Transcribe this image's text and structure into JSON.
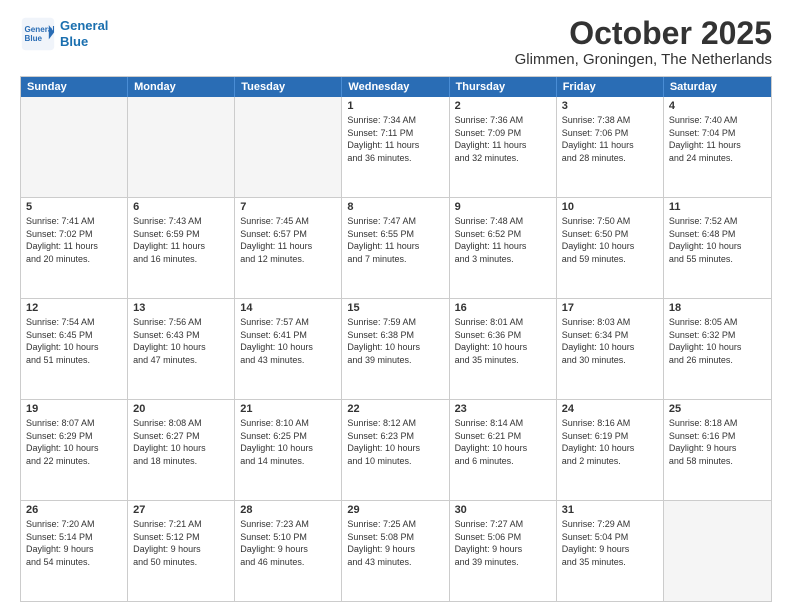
{
  "logo": {
    "line1": "General",
    "line2": "Blue"
  },
  "title": "October 2025",
  "subtitle": "Glimmen, Groningen, The Netherlands",
  "weekdays": [
    "Sunday",
    "Monday",
    "Tuesday",
    "Wednesday",
    "Thursday",
    "Friday",
    "Saturday"
  ],
  "rows": [
    [
      {
        "day": "",
        "info": ""
      },
      {
        "day": "",
        "info": ""
      },
      {
        "day": "",
        "info": ""
      },
      {
        "day": "1",
        "info": "Sunrise: 7:34 AM\nSunset: 7:11 PM\nDaylight: 11 hours\nand 36 minutes."
      },
      {
        "day": "2",
        "info": "Sunrise: 7:36 AM\nSunset: 7:09 PM\nDaylight: 11 hours\nand 32 minutes."
      },
      {
        "day": "3",
        "info": "Sunrise: 7:38 AM\nSunset: 7:06 PM\nDaylight: 11 hours\nand 28 minutes."
      },
      {
        "day": "4",
        "info": "Sunrise: 7:40 AM\nSunset: 7:04 PM\nDaylight: 11 hours\nand 24 minutes."
      }
    ],
    [
      {
        "day": "5",
        "info": "Sunrise: 7:41 AM\nSunset: 7:02 PM\nDaylight: 11 hours\nand 20 minutes."
      },
      {
        "day": "6",
        "info": "Sunrise: 7:43 AM\nSunset: 6:59 PM\nDaylight: 11 hours\nand 16 minutes."
      },
      {
        "day": "7",
        "info": "Sunrise: 7:45 AM\nSunset: 6:57 PM\nDaylight: 11 hours\nand 12 minutes."
      },
      {
        "day": "8",
        "info": "Sunrise: 7:47 AM\nSunset: 6:55 PM\nDaylight: 11 hours\nand 7 minutes."
      },
      {
        "day": "9",
        "info": "Sunrise: 7:48 AM\nSunset: 6:52 PM\nDaylight: 11 hours\nand 3 minutes."
      },
      {
        "day": "10",
        "info": "Sunrise: 7:50 AM\nSunset: 6:50 PM\nDaylight: 10 hours\nand 59 minutes."
      },
      {
        "day": "11",
        "info": "Sunrise: 7:52 AM\nSunset: 6:48 PM\nDaylight: 10 hours\nand 55 minutes."
      }
    ],
    [
      {
        "day": "12",
        "info": "Sunrise: 7:54 AM\nSunset: 6:45 PM\nDaylight: 10 hours\nand 51 minutes."
      },
      {
        "day": "13",
        "info": "Sunrise: 7:56 AM\nSunset: 6:43 PM\nDaylight: 10 hours\nand 47 minutes."
      },
      {
        "day": "14",
        "info": "Sunrise: 7:57 AM\nSunset: 6:41 PM\nDaylight: 10 hours\nand 43 minutes."
      },
      {
        "day": "15",
        "info": "Sunrise: 7:59 AM\nSunset: 6:38 PM\nDaylight: 10 hours\nand 39 minutes."
      },
      {
        "day": "16",
        "info": "Sunrise: 8:01 AM\nSunset: 6:36 PM\nDaylight: 10 hours\nand 35 minutes."
      },
      {
        "day": "17",
        "info": "Sunrise: 8:03 AM\nSunset: 6:34 PM\nDaylight: 10 hours\nand 30 minutes."
      },
      {
        "day": "18",
        "info": "Sunrise: 8:05 AM\nSunset: 6:32 PM\nDaylight: 10 hours\nand 26 minutes."
      }
    ],
    [
      {
        "day": "19",
        "info": "Sunrise: 8:07 AM\nSunset: 6:29 PM\nDaylight: 10 hours\nand 22 minutes."
      },
      {
        "day": "20",
        "info": "Sunrise: 8:08 AM\nSunset: 6:27 PM\nDaylight: 10 hours\nand 18 minutes."
      },
      {
        "day": "21",
        "info": "Sunrise: 8:10 AM\nSunset: 6:25 PM\nDaylight: 10 hours\nand 14 minutes."
      },
      {
        "day": "22",
        "info": "Sunrise: 8:12 AM\nSunset: 6:23 PM\nDaylight: 10 hours\nand 10 minutes."
      },
      {
        "day": "23",
        "info": "Sunrise: 8:14 AM\nSunset: 6:21 PM\nDaylight: 10 hours\nand 6 minutes."
      },
      {
        "day": "24",
        "info": "Sunrise: 8:16 AM\nSunset: 6:19 PM\nDaylight: 10 hours\nand 2 minutes."
      },
      {
        "day": "25",
        "info": "Sunrise: 8:18 AM\nSunset: 6:16 PM\nDaylight: 9 hours\nand 58 minutes."
      }
    ],
    [
      {
        "day": "26",
        "info": "Sunrise: 7:20 AM\nSunset: 5:14 PM\nDaylight: 9 hours\nand 54 minutes."
      },
      {
        "day": "27",
        "info": "Sunrise: 7:21 AM\nSunset: 5:12 PM\nDaylight: 9 hours\nand 50 minutes."
      },
      {
        "day": "28",
        "info": "Sunrise: 7:23 AM\nSunset: 5:10 PM\nDaylight: 9 hours\nand 46 minutes."
      },
      {
        "day": "29",
        "info": "Sunrise: 7:25 AM\nSunset: 5:08 PM\nDaylight: 9 hours\nand 43 minutes."
      },
      {
        "day": "30",
        "info": "Sunrise: 7:27 AM\nSunset: 5:06 PM\nDaylight: 9 hours\nand 39 minutes."
      },
      {
        "day": "31",
        "info": "Sunrise: 7:29 AM\nSunset: 5:04 PM\nDaylight: 9 hours\nand 35 minutes."
      },
      {
        "day": "",
        "info": ""
      }
    ]
  ]
}
